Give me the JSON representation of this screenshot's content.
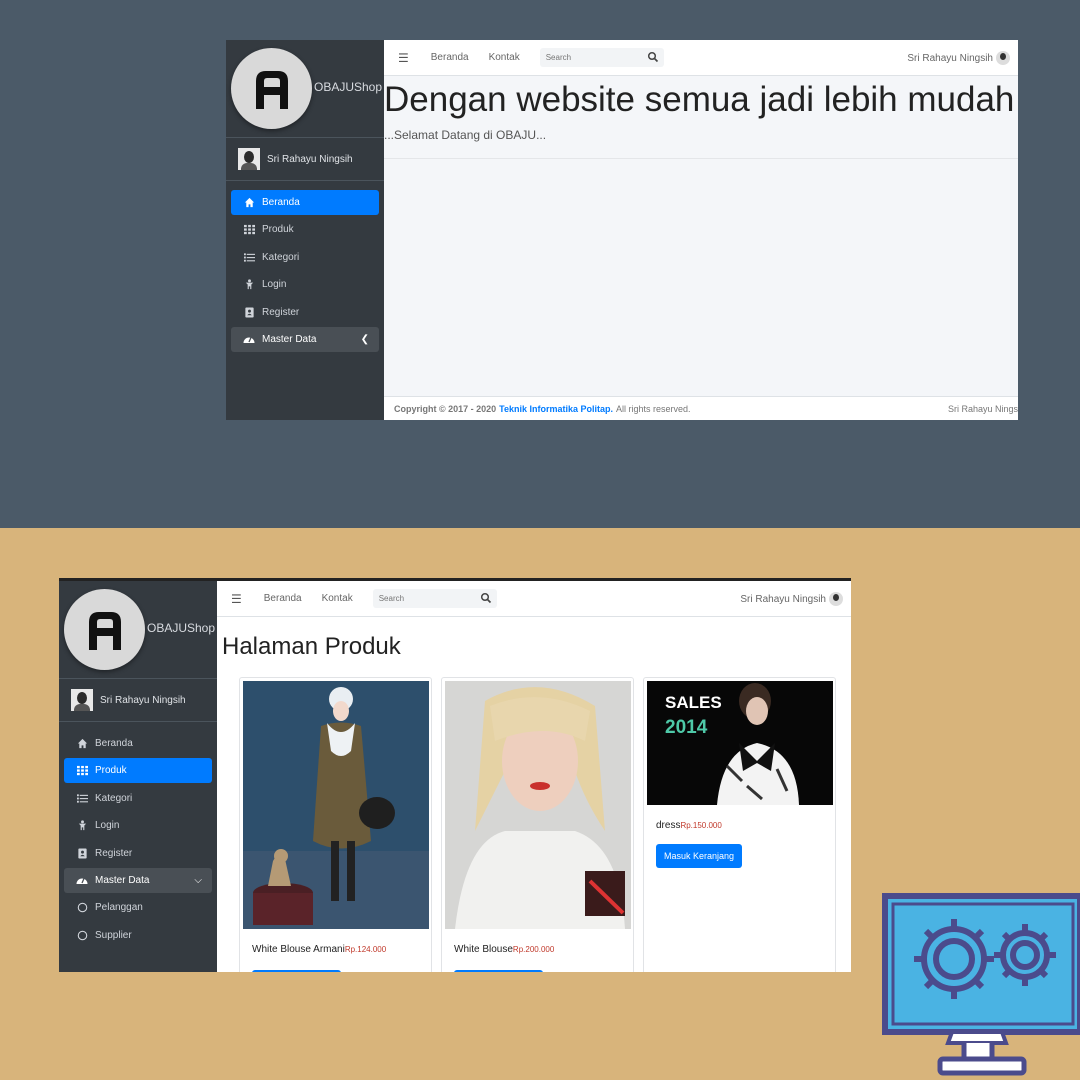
{
  "brand": {
    "name": "OBAJUShop",
    "logo_letter": "A"
  },
  "user": {
    "name": "Sri Rahayu Ningsih"
  },
  "topbar": {
    "links": [
      "Beranda",
      "Kontak"
    ],
    "search_placeholder": "Search",
    "user": "Sri Rahayu Ningsih"
  },
  "screen1": {
    "nav": [
      {
        "label": "Beranda",
        "icon": "home-icon",
        "active": true
      },
      {
        "label": "Produk",
        "icon": "grid-icon"
      },
      {
        "label": "Kategori",
        "icon": "list-icon"
      },
      {
        "label": "Login",
        "icon": "person-icon"
      },
      {
        "label": "Register",
        "icon": "id-card-icon"
      },
      {
        "label": "Master Data",
        "icon": "dashboard-icon",
        "chevron": "left"
      }
    ],
    "hero_title": "Dengan website semua jadi lebih mudah",
    "hero_subtitle": "...Selamat Datang di OBAJU...",
    "footer": {
      "copyright": "Copyright © 2017 - 2020",
      "org": "Teknik Informatika Politap.",
      "rights": "All rights reserved.",
      "right_text": "Sri Rahayu Nings"
    }
  },
  "screen2": {
    "nav": [
      {
        "label": "Beranda",
        "icon": "home-icon"
      },
      {
        "label": "Produk",
        "icon": "grid-icon",
        "active": true
      },
      {
        "label": "Kategori",
        "icon": "list-icon"
      },
      {
        "label": "Login",
        "icon": "person-icon"
      },
      {
        "label": "Register",
        "icon": "id-card-icon"
      },
      {
        "label": "Master Data",
        "icon": "dashboard-icon",
        "chevron": "down"
      },
      {
        "label": "Pelanggan",
        "icon": "circle-icon"
      },
      {
        "label": "Supplier",
        "icon": "circle-icon"
      }
    ],
    "page_title": "Halaman Produk",
    "products": [
      {
        "name": "White Blouse Armani",
        "price": "Rp.124.000"
      },
      {
        "name": "White Blouse",
        "price": "Rp.200.000"
      },
      {
        "name": "dress",
        "price": "Rp.150.000",
        "button": "Masuk Keranjang",
        "banner_line1": "SALES",
        "banner_line2": "2014"
      }
    ]
  },
  "colors": {
    "top_bg": "#4b5a68",
    "bottom_bg": "#d8b47b",
    "sidebar": "#343a40",
    "accent": "#007bff",
    "price": "#c0392b"
  }
}
